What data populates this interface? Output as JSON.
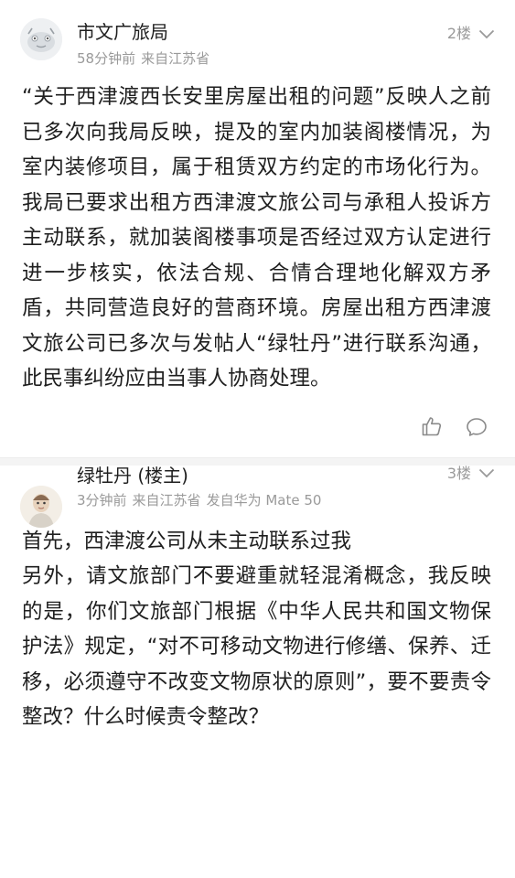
{
  "posts": [
    {
      "author": "市文广旅局",
      "time": "58分钟前",
      "location": "来自江苏省",
      "device": "",
      "floor": "2楼",
      "content": "“关于西津渡西长安里房屋出租的问题”反映人之前已多次向我局反映，提及的室内加装阁楼情况，为室内装修项目，属于租赁双方约定的市场化行为。我局已要求出租方西津渡文旅公司与承租人投诉方主动联系，就加装阁楼事项是否经过双方认定进行进一步核实，依法合规、合情合理地化解双方矛盾，共同营造良好的营商环境。房屋出租方西津渡文旅公司已多次与发帖人“绿牡丹”进行联系沟通，此民事纠纷应由当事人协商处理。"
    },
    {
      "author": "绿牡丹 (楼主)",
      "time": "3分钟前",
      "location": "来自江苏省",
      "device": "发自华为 Mate 50",
      "floor": "3楼",
      "content": "首先，西津渡公司从未主动联系过我\n另外，请文旅部门不要避重就轻混淆概念，我反映的是，你们文旅部门根据《中华人民共和国文物保护法》规定，“对不可移动文物进行修缮、保养、迁移，必须遵守不改变文物原状的原则”，要不要责令整改？什么时候责令整改？"
    }
  ],
  "icons": {
    "like": "thumbs-up-icon",
    "comment": "comment-bubble-icon",
    "expand": "chevron-down-icon"
  },
  "colors": {
    "meta_text": "#9a9a9a",
    "body_text": "#1f1f1f",
    "divider": "#f4f4f4"
  }
}
